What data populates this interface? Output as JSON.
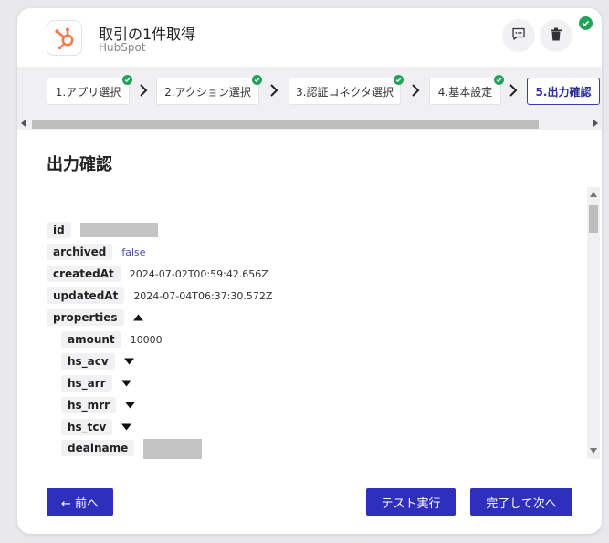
{
  "header": {
    "title": "取引の1件取得",
    "subtitle": "HubSpot",
    "app_icon": "hubspot-logo-icon",
    "comment_icon": "comment-icon",
    "delete_icon": "trash-icon",
    "status_icon": "check-circle-icon",
    "status_color": "#23a35a"
  },
  "steps": [
    {
      "label": "1.アプリ選択",
      "done": true
    },
    {
      "label": "2.アクション選択",
      "done": true
    },
    {
      "label": "3.認証コネクタ選択",
      "done": true
    },
    {
      "label": "4.基本設定",
      "done": true
    },
    {
      "label": "5.出力確認",
      "active": true
    }
  ],
  "main": {
    "section_title": "出力確認",
    "fields": [
      {
        "key": "id",
        "value": ""
      },
      {
        "key": "archived",
        "value": "false"
      },
      {
        "key": "createdAt",
        "value": "2024-07-02T00:59:42.656Z"
      },
      {
        "key": "updatedAt",
        "value": "2024-07-04T06:37:30.572Z"
      },
      {
        "key": "properties",
        "expanded": true
      },
      {
        "key": "amount",
        "value": "10000",
        "nested": true
      },
      {
        "key": "hs_acv",
        "nested": true,
        "expanded": false
      },
      {
        "key": "hs_arr",
        "nested": true,
        "expanded": false
      },
      {
        "key": "hs_mrr",
        "nested": true,
        "expanded": false
      },
      {
        "key": "hs_tcv",
        "nested": true,
        "expanded": false
      },
      {
        "key": "dealname",
        "value": "",
        "nested": true
      }
    ]
  },
  "footer": {
    "back_label": "← 前へ",
    "test_label": "テスト実行",
    "next_label": "完了して次へ"
  },
  "colors": {
    "accent": "#2f2fbd",
    "success": "#23a35a",
    "hubspot": "#f5794f"
  }
}
